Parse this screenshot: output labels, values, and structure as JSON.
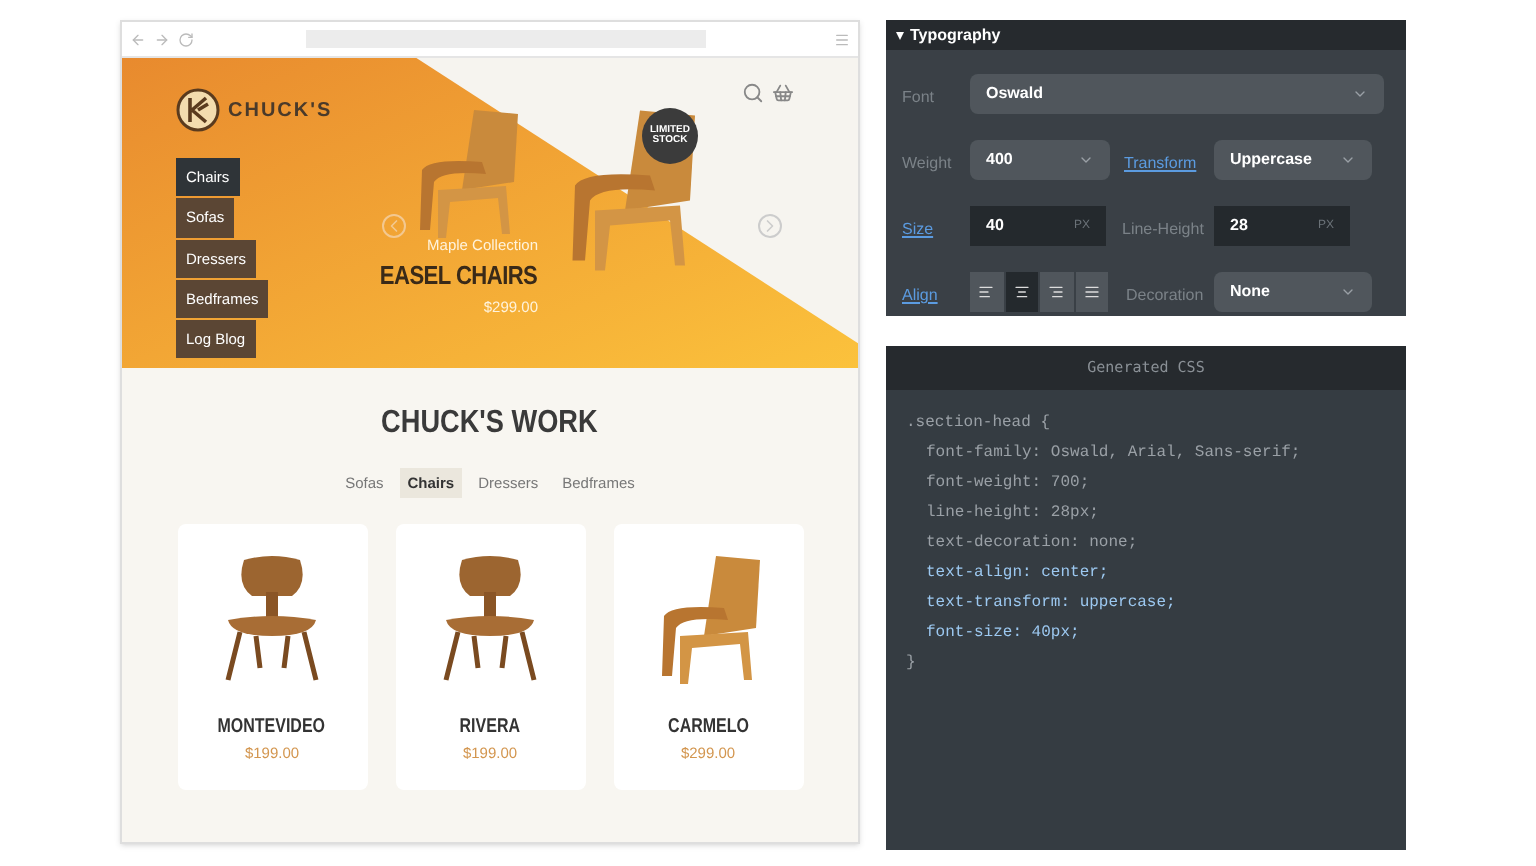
{
  "hero": {
    "logo_text": "CHUCK'S",
    "menu": [
      {
        "label": "Chairs",
        "selected": true
      },
      {
        "label": "Sofas",
        "selected": false
      },
      {
        "label": "Dressers",
        "selected": false
      },
      {
        "label": "Bedframes",
        "selected": false
      },
      {
        "label": "Log Blog",
        "selected": false
      }
    ],
    "badge": "LIMITED STOCK",
    "collection": "Maple Collection",
    "title": "EASEL CHAIRS",
    "price": "$299.00"
  },
  "section": {
    "title": "CHUCK'S WORK",
    "tabs": [
      {
        "label": "Sofas",
        "selected": false
      },
      {
        "label": "Chairs",
        "selected": true
      },
      {
        "label": "Dressers",
        "selected": false
      },
      {
        "label": "Bedframes",
        "selected": false
      }
    ],
    "products": [
      {
        "name": "MONTEVIDEO",
        "price": "$199.00",
        "kind": "side"
      },
      {
        "name": "RIVERA",
        "price": "$199.00",
        "kind": "side"
      },
      {
        "name": "CARMELO",
        "price": "$299.00",
        "kind": "lounge"
      }
    ]
  },
  "typography": {
    "title": "Typography",
    "expanded": true,
    "font": {
      "label": "Font",
      "value": "Oswald"
    },
    "weight": {
      "label": "Weight",
      "value": "400"
    },
    "transform": {
      "label": "Transform",
      "value": "Uppercase"
    },
    "size": {
      "label": "Size",
      "value": "40",
      "unit": "PX"
    },
    "line_height": {
      "label": "Line-Height",
      "value": "28",
      "unit": "PX"
    },
    "align": {
      "label": "Align",
      "options": [
        {
          "kind": "left",
          "selected": false
        },
        {
          "kind": "center",
          "selected": true
        },
        {
          "kind": "right",
          "selected": false
        },
        {
          "kind": "justify",
          "selected": false
        }
      ]
    },
    "decoration": {
      "label": "Decoration",
      "value": "None"
    }
  },
  "css": {
    "title": "Generated CSS",
    "lines": [
      {
        "text": ".section-head {",
        "kind": "selector",
        "highlighted": false
      },
      {
        "text": "font-family: Oswald, Arial, Sans-serif;",
        "kind": "declaration",
        "highlighted": false
      },
      {
        "text": "font-weight: 700;",
        "kind": "declaration",
        "highlighted": false
      },
      {
        "text": "line-height: 28px;",
        "kind": "declaration",
        "highlighted": false
      },
      {
        "text": "text-decoration: none;",
        "kind": "declaration",
        "highlighted": false
      },
      {
        "text": "text-align: center;",
        "kind": "declaration",
        "highlighted": true
      },
      {
        "text": "text-transform: uppercase;",
        "kind": "declaration",
        "highlighted": true
      },
      {
        "text": "font-size: 40px;",
        "kind": "declaration",
        "highlighted": true
      },
      {
        "text": "}",
        "kind": "selector",
        "highlighted": false
      }
    ]
  }
}
